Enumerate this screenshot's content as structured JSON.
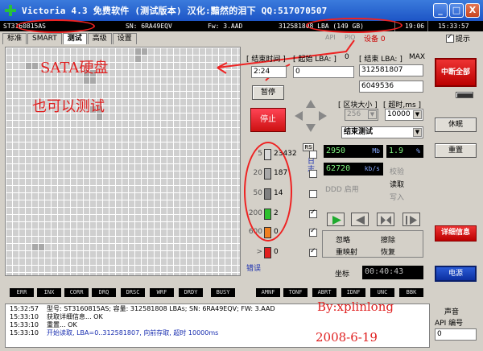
{
  "window": {
    "title": "Victoria 4.3 免费软件 (测试版本)  汉化:黯然的泪下   QQ:517070507",
    "btn_min": "_",
    "btn_max": "□",
    "btn_close": "X"
  },
  "infobar": {
    "model": "ST3160815AS",
    "sn": "SN: 6RA49EQV",
    "fw": "Fw: 3.AAD",
    "lba": "312581808 LBA (149 GB)",
    "time1": "19:06",
    "time2": "15:33:57"
  },
  "tabs": [
    "标准",
    "SMART",
    "测试",
    "高级",
    "设置"
  ],
  "active_tab": 2,
  "topbar": {
    "radio_api": "API",
    "radio_pio": "PIO",
    "device_label": "设备 0",
    "hint_label": "提示"
  },
  "annotations": {
    "sata": "SATA硬盘",
    "also": "也可以测试",
    "by": "By:xplinlong",
    "date": "2008-6-19"
  },
  "test": {
    "end_time_label": "[ 结束时间 ]",
    "time_value": "2:24",
    "start_lba_label": "[ 起始 LBA: ]",
    "start_lba_zero": "0",
    "start_lba_value": "0",
    "end_lba_label": "[ 结束 LBA: ]",
    "end_lba_max": "MAX",
    "end_lba_value": "312581807",
    "current_value": "6049536",
    "pause_label": "暂停",
    "stop_label": "停止",
    "block_label": "[ 区块大小 ]",
    "timeout_label": "[ 超时,ms ]",
    "block_value": "256",
    "timeout_value": "10000",
    "mode_value": "结束测试",
    "rs_label": "RS",
    "vertical_label": "日志",
    "ddd_label": "DDD 启用",
    "remap_label": "错误",
    "speed_value": "2950",
    "speed_unit": "Mb",
    "percent_value": "1.9",
    "percent_unit": "%",
    "rate_value": "62720",
    "rate_unit": "kb/s",
    "verify_label": "校验",
    "read_label": "读取",
    "write_label": "写入",
    "ignore_label": "忽略",
    "erase_label": "擦除",
    "remap_opt_label": "重映射",
    "restore_label": "恢复",
    "grid_label": "坐标",
    "elapsed": "00:40:43"
  },
  "counters": [
    {
      "label": "5",
      "value": "23432",
      "color": "#d8d8d8"
    },
    {
      "label": "20",
      "value": "187",
      "color": "#a8a8a8"
    },
    {
      "label": "50",
      "value": "14",
      "color": "#808080"
    },
    {
      "label": "200",
      "value": "2",
      "color": "#2ec02e"
    },
    {
      "label": "600",
      "value": "0",
      "color": "#f08020"
    },
    {
      "label": ">",
      "value": "0",
      "color": "#e02020"
    }
  ],
  "side": {
    "break_all": "中断全部",
    "sleep": "休眠",
    "reset": "重置",
    "details": "详细信息",
    "power": "电源",
    "sound": "声音",
    "api_label": "API 编号",
    "api_value": "0"
  },
  "leds": [
    "ERR",
    "INX",
    "CORR",
    "DRQ",
    "DRSC",
    "WRF",
    "DRDY",
    "BUSY",
    "AMNF",
    "TONF",
    "ABRT",
    "IDNF",
    "UNC",
    "BBK"
  ],
  "log": [
    {
      "time": "15:32:57",
      "msg": "型号: ST3160815AS;      容量: 312581808 LBAs; SN: 6RA49EQV; FW: 3.AAD",
      "blue": false
    },
    {
      "time": "15:33:10",
      "msg": "获取详细信息... OK",
      "blue": false
    },
    {
      "time": "15:33:10",
      "msg": "重置... OK",
      "blue": false
    },
    {
      "time": "15:33:10",
      "msg": "开始读取, LBA=0..312581807, 向前存取, 超时 10000ms",
      "blue": true
    }
  ]
}
